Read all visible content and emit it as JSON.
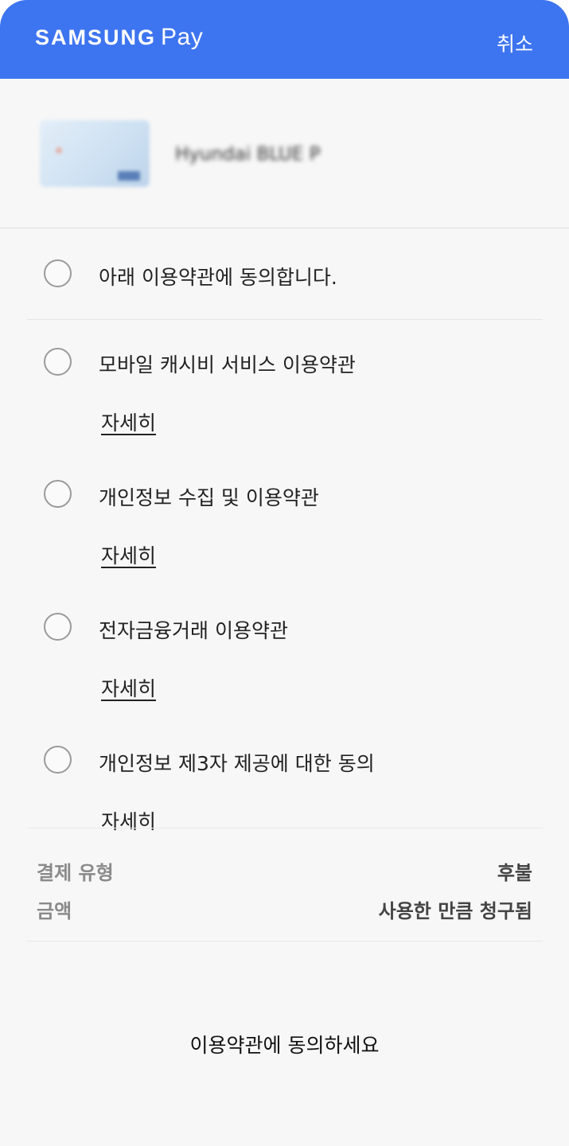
{
  "header": {
    "logo_brand": "SAMSUNG",
    "logo_product": "Pay",
    "cancel_label": "취소",
    "color": "#3d74f0"
  },
  "card": {
    "name": "Hyundai BLUE P"
  },
  "terms": [
    {
      "label": "아래 이용약관에 동의합니다.",
      "detail": ""
    },
    {
      "label": "모바일 캐시비 서비스 이용약관",
      "detail": "자세히"
    },
    {
      "label": "개인정보 수집 및 이용약관",
      "detail": "자세히"
    },
    {
      "label": "전자금융거래 이용약관",
      "detail": "자세히"
    },
    {
      "label": "개인정보 제3자 제공에 대한 동의",
      "detail": "자세히"
    }
  ],
  "summary": {
    "payment_type_label": "결제 유형",
    "payment_type_value": "후불",
    "amount_label": "금액",
    "amount_value": "사용한 만큼 청구됨"
  },
  "footer": {
    "message": "이용약관에 동의하세요"
  }
}
